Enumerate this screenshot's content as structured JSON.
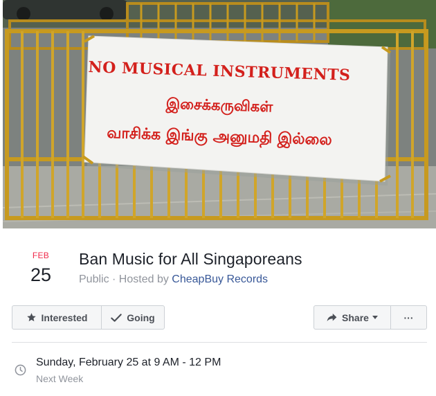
{
  "cover": {
    "banner_line1": "NO MUSICAL INSTRUMENTS",
    "banner_line2": "இசைக்கருவிகள்",
    "banner_line3": "வாசிக்க இங்கு அனுமதி இல்லை"
  },
  "event": {
    "month": "FEB",
    "day": "25",
    "title": "Ban Music for All Singaporeans",
    "privacy": "Public",
    "hosted_by_prefix": "· Hosted by ",
    "host": "CheapBuy Records"
  },
  "actions": {
    "interested_label": "Interested",
    "going_label": "Going",
    "share_label": "Share",
    "more_label": "···"
  },
  "details": {
    "time": "Sunday, February 25 at 9 AM - 12 PM",
    "relative": "Next Week"
  },
  "colors": {
    "month_red": "#f02849",
    "host_link": "#385898",
    "banner_text_red": "#d3201c",
    "barrier_yellow": "#c79a1f"
  },
  "icons": {
    "interested": "star-icon",
    "going": "check-icon",
    "share": "share-arrow-icon",
    "time": "clock-icon"
  }
}
